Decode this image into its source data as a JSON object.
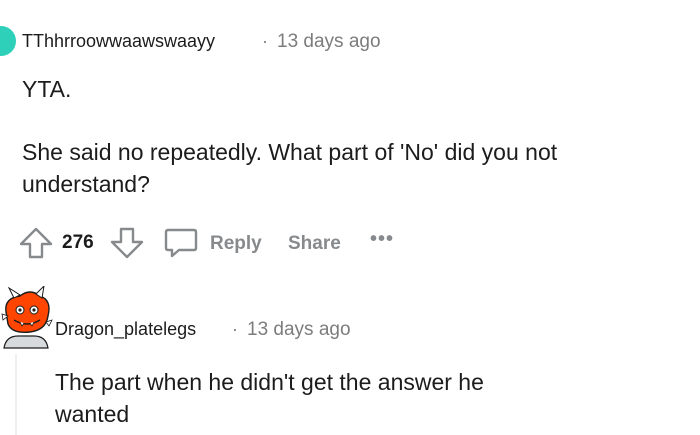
{
  "comments": [
    {
      "username": "TThhrroowwaawswaayy",
      "separator": "·",
      "time": "13 days ago",
      "paragraphs": [
        "YTA.",
        "She said no repeatedly. What part of 'No' did you not",
        "understand?"
      ],
      "score": "276",
      "actions": {
        "reply": "Reply",
        "share": "Share",
        "more": "•••"
      },
      "avatar_color": "#2fd0b9"
    },
    {
      "username": "Dragon_platelegs",
      "separator": "·",
      "time": "13 days ago",
      "paragraphs": [
        "The part when he didn't get the answer he",
        "wanted"
      ]
    }
  ],
  "icons": [
    "upvote-icon",
    "downvote-icon",
    "comment-icon",
    "snoo-avatar-icon"
  ]
}
